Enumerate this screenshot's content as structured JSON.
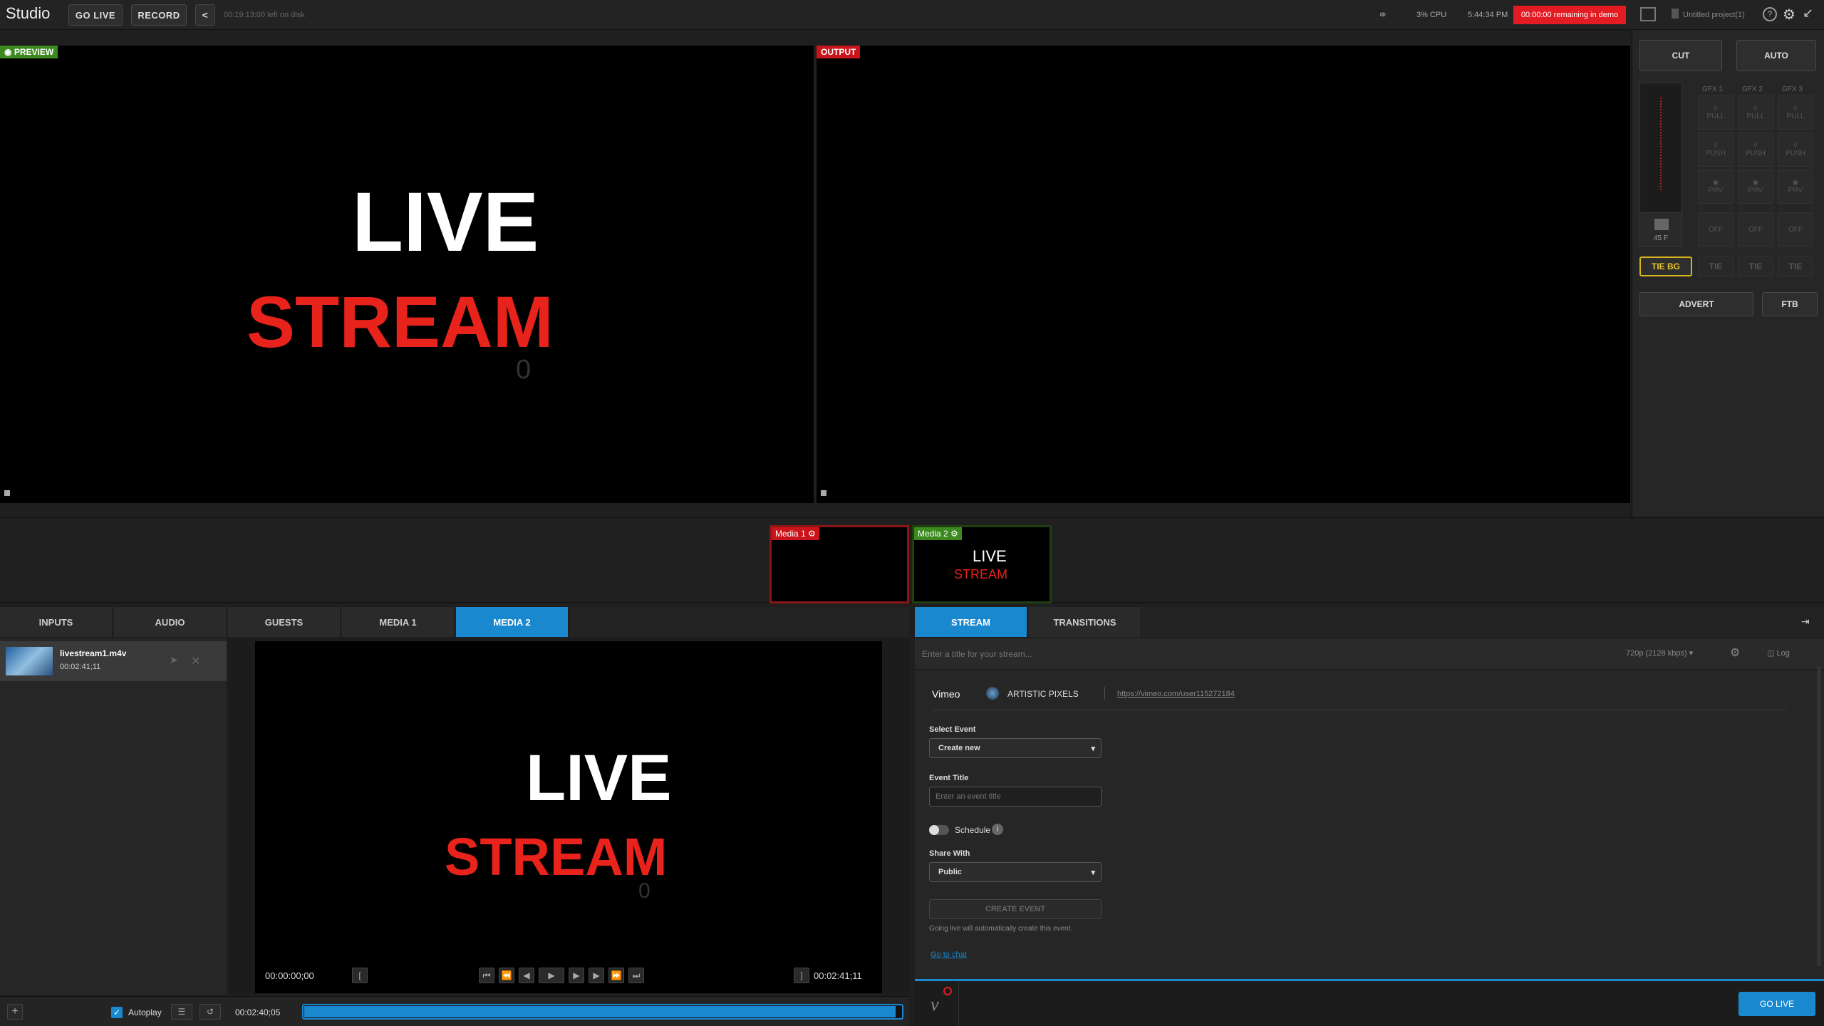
{
  "app": {
    "title": "Studio"
  },
  "topbar": {
    "go_live": "GO LIVE",
    "record": "RECORD",
    "disk": "00:19:13:00 left on disk",
    "cpu": "3% CPU",
    "time": "5:44:34 PM",
    "demo": "00:00:00 remaining in demo",
    "project": "Untitled project(1)"
  },
  "preview": {
    "label": "PREVIEW",
    "live": "LIVE",
    "stream": "STREAM",
    "counter": "0"
  },
  "output": {
    "label": "OUTPUT"
  },
  "rpanel": {
    "cut": "CUT",
    "auto": "AUTO",
    "gfx": [
      "GFX 1",
      "GFX 2",
      "GFX 3"
    ],
    "pull": "PULL",
    "push": "PUSH",
    "prv": "PRV",
    "off": "OFF",
    "frames": "45 F",
    "tie_bg": "TIE BG",
    "tie": "TIE",
    "advert": "ADVERT",
    "ftb": "FTB"
  },
  "bus": [
    {
      "label": "Media 1"
    },
    {
      "label": "Media 2",
      "live": "LIVE",
      "stream": "STREAM"
    }
  ],
  "left_tabs": [
    "INPUTS",
    "AUDIO",
    "GUESTS",
    "MEDIA 1",
    "MEDIA 2"
  ],
  "playlist": {
    "items": [
      {
        "name": "livestream1.m4v",
        "duration": "00:02:41;11"
      }
    ],
    "autoplay": "Autoplay"
  },
  "media_player": {
    "live": "LIVE",
    "stream": "STREAM",
    "counter": "0",
    "time_in": "00:00:00;00",
    "time_out": "00:02:41;11",
    "position": "00:02:40;05",
    "progress": 0.99
  },
  "right_tabs": [
    "STREAM",
    "TRANSITIONS"
  ],
  "stream": {
    "title_placeholder": "Enter a title for your stream...",
    "quality": "720p (2128 kbps)",
    "log": "Log",
    "service": "Vimeo",
    "account": "ARTISTIC PIXELS",
    "url": "https://vimeo.com/user115272184",
    "select_event_label": "Select Event",
    "select_event_value": "Create new",
    "event_title_label": "Event Title",
    "event_title_placeholder": "Enter an event title",
    "schedule": "Schedule",
    "share_label": "Share With",
    "share_value": "Public",
    "create_event": "CREATE EVENT",
    "note": "Going live will automatically create this event.",
    "chat": "Go to chat",
    "go_live": "GO LIVE"
  },
  "colors": {
    "accent": "#1a88cf",
    "preview": "#3c8a1f",
    "output": "#c8141a",
    "red_text": "#e8231c",
    "demo": "#e31b23"
  }
}
